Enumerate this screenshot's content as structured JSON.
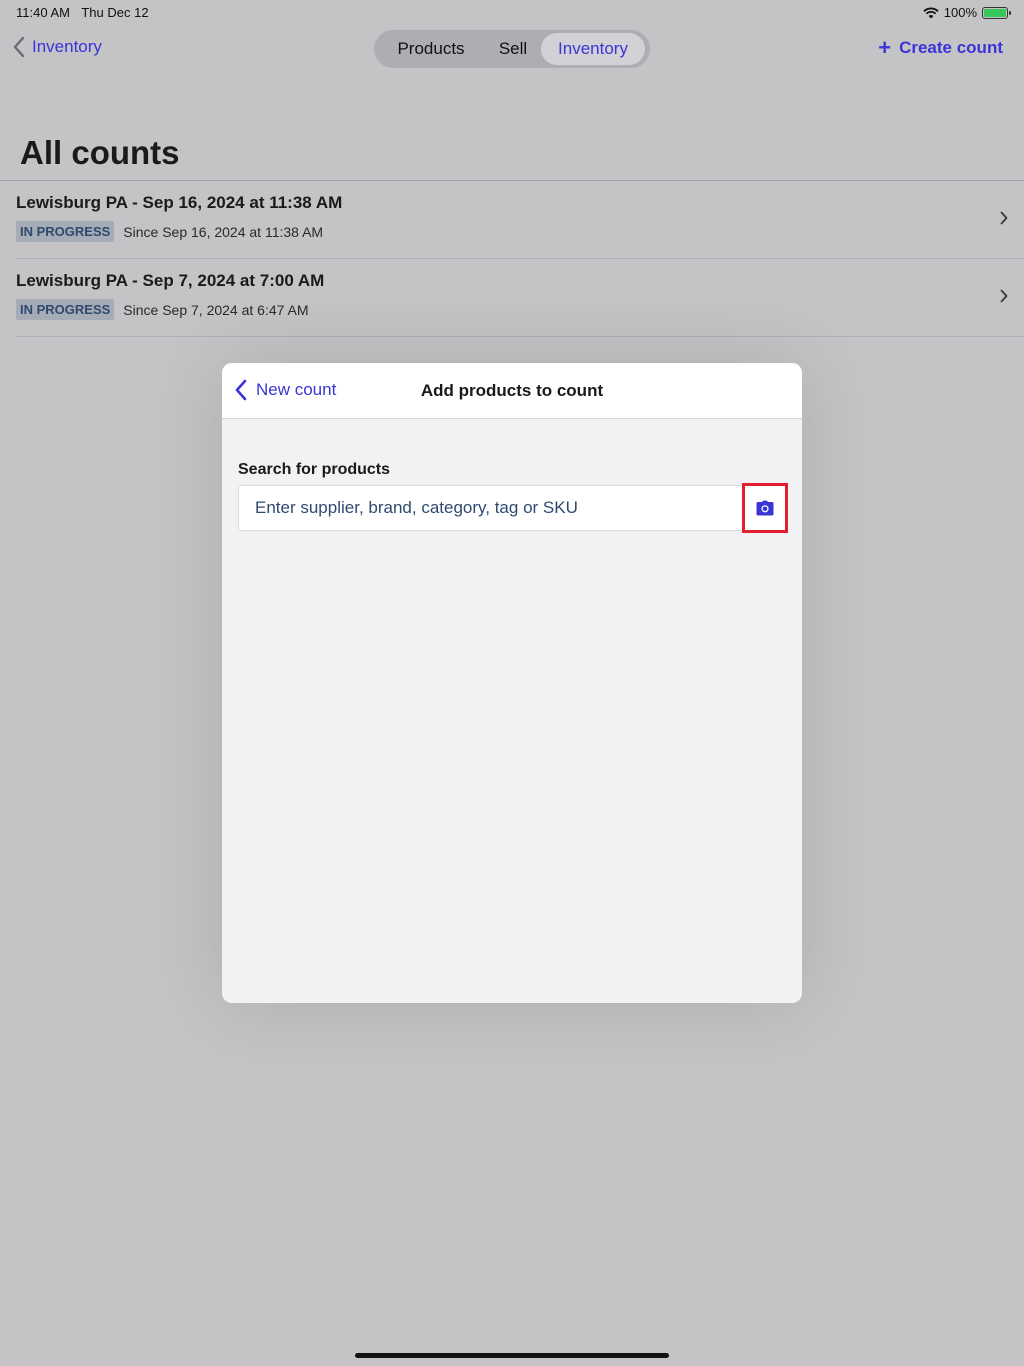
{
  "status_bar": {
    "time": "11:40 AM",
    "date": "Thu Dec 12",
    "battery": "100%"
  },
  "nav": {
    "back_label": "Inventory",
    "segments": [
      {
        "label": "Products",
        "selected": false
      },
      {
        "label": "Sell",
        "selected": false
      },
      {
        "label": "Inventory",
        "selected": true
      }
    ],
    "create_label": "Create count"
  },
  "page": {
    "title": "All counts"
  },
  "counts": [
    {
      "title": "Lewisburg PA - Sep 16, 2024 at 11:38 AM",
      "status": "IN PROGRESS",
      "since": "Since Sep 16, 2024 at 11:38 AM"
    },
    {
      "title": "Lewisburg PA - Sep 7, 2024 at 7:00 AM",
      "status": "IN PROGRESS",
      "since": "Since Sep 7, 2024 at 6:47 AM"
    }
  ],
  "modal": {
    "back_label": "New count",
    "title": "Add products to count",
    "search_label": "Search for products",
    "search_placeholder": "Enter supplier, brand, category, tag or SKU",
    "search_value": ""
  },
  "colors": {
    "accent": "#3b34d6",
    "highlight": "#e0202e",
    "badge_bg": "#a5acb6",
    "badge_text": "#2e4a6e"
  },
  "icons": {
    "back": "chevron-left-icon",
    "row": "chevron-right-icon",
    "create": "plus-icon",
    "scan": "camera-icon",
    "wifi": "wifi-icon",
    "battery": "battery-charging-icon"
  }
}
